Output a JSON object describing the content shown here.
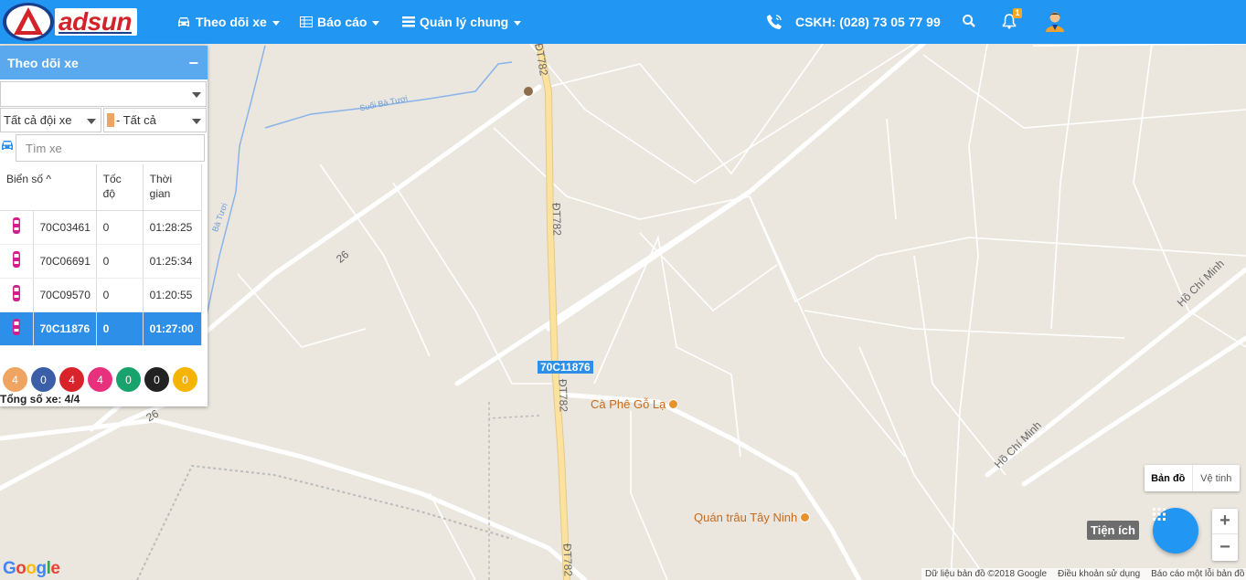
{
  "brand": {
    "name": "adsun",
    "reg": "®"
  },
  "nav": {
    "tracking": "Theo dõi xe",
    "reports": "Báo cáo",
    "management": "Quản lý chung",
    "hotline": "CSKH: (028) 73 05 77 99",
    "notif_count": "1"
  },
  "panel": {
    "title": "Theo dõi xe",
    "minimize": "−",
    "main_select": "",
    "fleet_select": "Tất cả đội xe",
    "status_select": "- Tất cả",
    "search_placeholder": "Tìm xe",
    "headers": {
      "plate": "Biển số",
      "speed": "Tốc độ",
      "time": "Thời gian"
    },
    "vehicles": [
      {
        "plate": "70C03461",
        "speed": "0",
        "time": "01:28:25"
      },
      {
        "plate": "70C06691",
        "speed": "0",
        "time": "01:25:34"
      },
      {
        "plate": "70C09570",
        "speed": "0",
        "time": "01:20:55"
      },
      {
        "plate": "70C11876",
        "speed": "0",
        "time": "01:27:00"
      }
    ],
    "status_counts": [
      {
        "value": "4",
        "color": "#f0a461"
      },
      {
        "value": "0",
        "color": "#3a5ea8"
      },
      {
        "value": "4",
        "color": "#d8232a"
      },
      {
        "value": "4",
        "color": "#e8317c"
      },
      {
        "value": "0",
        "color": "#19a36c"
      },
      {
        "value": "0",
        "color": "#222222"
      },
      {
        "value": "0",
        "color": "#f4b400"
      }
    ],
    "total": "Tổng số xe: 4/4"
  },
  "map": {
    "road_labels": {
      "dt782_a": "ĐT782",
      "dt782_b": "ĐT782",
      "dt782_c": "ĐT782",
      "dt782_d": "ĐT782",
      "r26_a": "26",
      "r26_b": "26",
      "hcm_a": "Hồ Chí Minh",
      "hcm_b": "Hồ Chí Minh",
      "suoi": "Suối Bà Tươi",
      "batuoi": "Bà Tươi"
    },
    "poi_cafe": "Cà Phê Gỗ Lạ",
    "poi_quan": "Quán trâu Tây Ninh",
    "vehicle_label": "70C11876",
    "map_type": "Bản đồ",
    "satellite": "Vệ tinh",
    "utilities": "Tiện ích",
    "zoom_in": "+",
    "zoom_out": "−",
    "google": "Google",
    "footer": {
      "data": "Dữ liệu bản đồ ©2018 Google",
      "terms": "Điều khoản sử dụng",
      "report": "Báo cáo một lỗi bản đồ"
    }
  }
}
